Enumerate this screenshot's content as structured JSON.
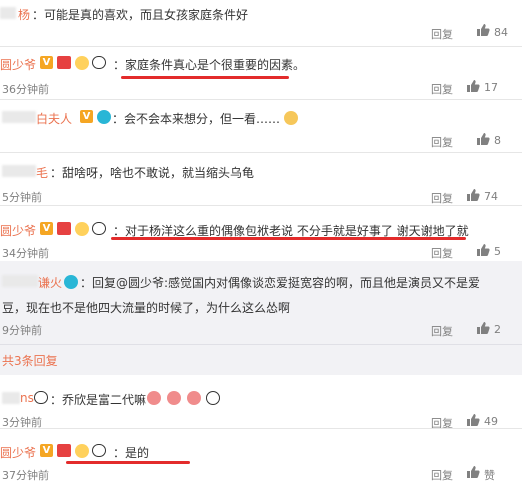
{
  "comments": [
    {
      "username": "杨",
      "text": "：可能是真的喜欢，而且女孩家庭条件好",
      "reply_label": "回复",
      "likes": "84"
    },
    {
      "username": "圆少爷",
      "text": "：家庭条件真心是个很重要的因素。",
      "time": "36分钟前",
      "reply_label": "回复",
      "likes": "17"
    },
    {
      "username": "白夫人",
      "text": "：会不会本来想分，但一看……",
      "reply_label": "回复",
      "likes": "8"
    },
    {
      "username": "毛",
      "text": "：甜啥呀，啥也不敢说，就当缩头乌龟",
      "time": "5分钟前",
      "reply_label": "回复",
      "likes": "74"
    },
    {
      "username": "圆少爷",
      "text": "：对于杨洋这么重的偶像包袱老说 不分手就是好事了 谢天谢地了就",
      "time": "34分钟前",
      "reply_label": "回复",
      "likes": "5"
    },
    {
      "username": "谦火",
      "text_line1": "：回复@圆少爷:感觉国内对偶像谈恋爱挺宽容的啊，而且他是演员又不是爱",
      "text_line2": "豆，现在也不是他四大流量的时候了，为什么这么怂啊",
      "time": "9分钟前",
      "reply_label": "回复",
      "likes": "2"
    },
    {
      "total_replies": "共3条回复"
    },
    {
      "username": "ns",
      "text": "：乔欣是富二代嘛",
      "time": "3分钟前",
      "reply_label": "回复",
      "likes": "49"
    },
    {
      "username": "圆少爷",
      "text": "：是的",
      "time": "37分钟前",
      "reply_label": "回复",
      "likes": "赞"
    }
  ]
}
